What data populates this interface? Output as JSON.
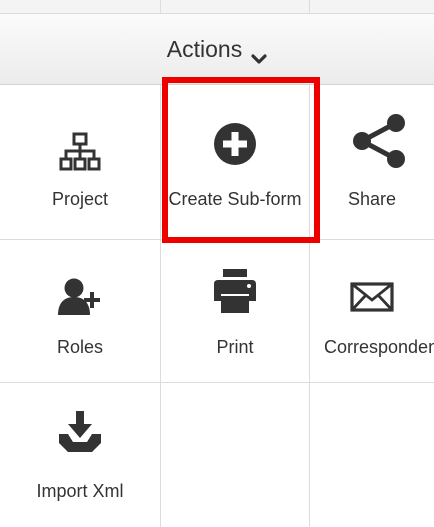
{
  "actions_bar": {
    "label": "Actions",
    "chevron_icon": "chevron-down-icon"
  },
  "accent_colors": {
    "highlight": "#ee0000",
    "icon": "#333333"
  },
  "actions": [
    {
      "label": "Project",
      "icon": "sitemap-icon"
    },
    {
      "label": "Create Sub-form",
      "icon": "plus-circle-icon"
    },
    {
      "label": "Share",
      "icon": "share-icon"
    },
    {
      "label": "Roles",
      "icon": "add-user-icon"
    },
    {
      "label": "Print",
      "icon": "print-icon"
    },
    {
      "label": "Correspondence",
      "icon": "envelope-icon"
    },
    {
      "label": "Import Xml",
      "icon": "import-icon"
    }
  ]
}
